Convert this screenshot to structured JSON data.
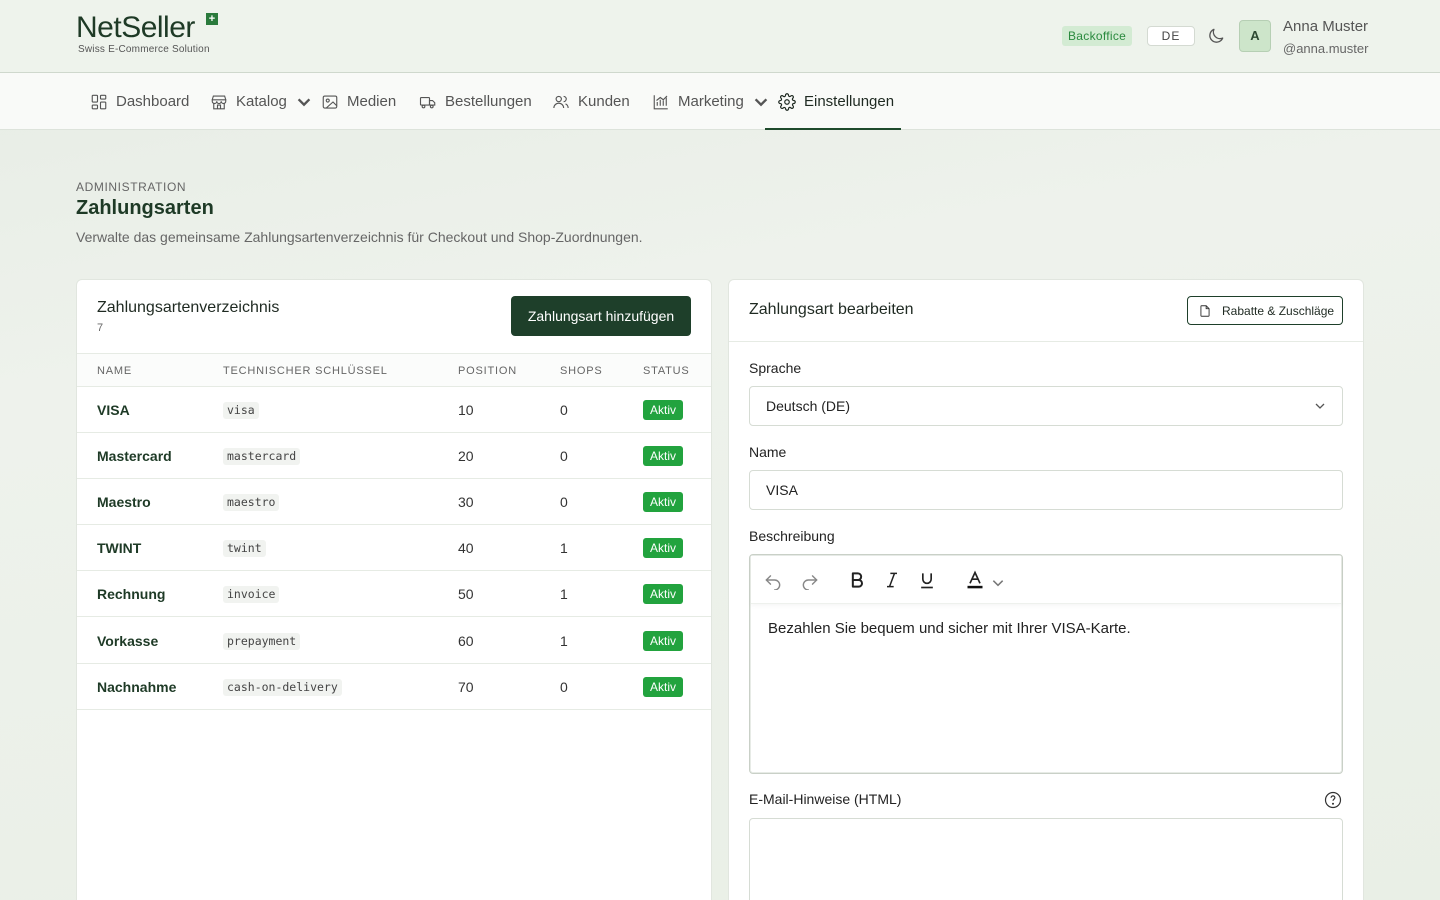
{
  "brand": {
    "name_part1": "Net",
    "name_part2": "Seller",
    "tagline": "Swiss E-Commerce Solution",
    "accent": "#1e3f2a"
  },
  "header": {
    "badge": "Backoffice",
    "language": "DE",
    "avatar_initial": "A",
    "user_name": "Anna Muster",
    "user_handle": "@anna.muster"
  },
  "nav": {
    "items": [
      {
        "label": "Dashboard",
        "icon": "dashboard-icon"
      },
      {
        "label": "Katalog",
        "icon": "store-icon"
      },
      {
        "label": "Medien",
        "icon": "image-icon"
      },
      {
        "label": "Bestellungen",
        "icon": "truck-icon"
      },
      {
        "label": "Kunden",
        "icon": "users-icon"
      },
      {
        "label": "Marketing",
        "icon": "chart-icon"
      },
      {
        "label": "Einstellungen",
        "icon": "gear-icon"
      }
    ],
    "active": "Einstellungen"
  },
  "page": {
    "eyebrow": "ADMINISTRATION",
    "title": "Zahlungsarten",
    "description": "Verwalte das gemeinsame Zahlungsartenverzeichnis für Checkout und Shop-Zuordnungen."
  },
  "list_panel": {
    "title": "Zahlungsartenverzeichnis",
    "count": "7",
    "add_button": "Zahlungsart hinzufügen",
    "columns": [
      "NAME",
      "TECHNISCHER SCHLÜSSEL",
      "POSITION",
      "SHOPS",
      "STATUS"
    ],
    "rows": [
      {
        "name": "VISA",
        "key": "visa",
        "position": "10",
        "shops": "0",
        "status": "Aktiv"
      },
      {
        "name": "Mastercard",
        "key": "mastercard",
        "position": "20",
        "shops": "0",
        "status": "Aktiv"
      },
      {
        "name": "Maestro",
        "key": "maestro",
        "position": "30",
        "shops": "0",
        "status": "Aktiv"
      },
      {
        "name": "TWINT",
        "key": "twint",
        "position": "40",
        "shops": "1",
        "status": "Aktiv"
      },
      {
        "name": "Rechnung",
        "key": "invoice",
        "position": "50",
        "shops": "1",
        "status": "Aktiv"
      },
      {
        "name": "Vorkasse",
        "key": "prepayment",
        "position": "60",
        "shops": "1",
        "status": "Aktiv"
      },
      {
        "name": "Nachnahme",
        "key": "cash-on-delivery",
        "position": "70",
        "shops": "0",
        "status": "Aktiv"
      }
    ]
  },
  "edit_panel": {
    "title": "Zahlungsart bearbeiten",
    "rabatte_button": "Rabatte & Zuschläge",
    "language_label": "Sprache",
    "language_value": "Deutsch (DE)",
    "name_label": "Name",
    "name_value": "VISA",
    "description_label": "Beschreibung",
    "description_value": "Bezahlen Sie bequem und sicher mit Ihrer VISA-Karte.",
    "email_label": "E-Mail-Hinweise (HTML)",
    "email_value": ""
  }
}
